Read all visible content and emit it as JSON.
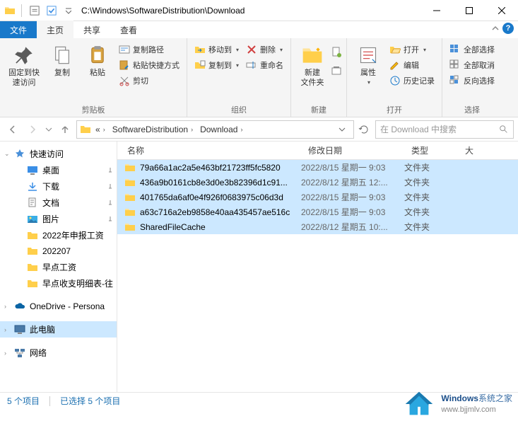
{
  "window": {
    "title": "C:\\Windows\\SoftwareDistribution\\Download"
  },
  "tabs": {
    "file": "文件",
    "home": "主页",
    "share": "共享",
    "view": "查看"
  },
  "ribbon": {
    "clipboard": {
      "pin": "固定到快\n速访问",
      "copy": "复制",
      "paste": "粘贴",
      "cut": "剪切",
      "copy_path": "复制路径",
      "paste_shortcut": "粘贴快捷方式",
      "label": "剪贴板"
    },
    "organize": {
      "move_to": "移动到",
      "copy_to": "复制到",
      "delete": "删除",
      "rename": "重命名",
      "label": "组织"
    },
    "new": {
      "new_folder": "新建\n文件夹",
      "label": "新建"
    },
    "open": {
      "properties": "属性",
      "open": "打开",
      "edit": "编辑",
      "history": "历史记录",
      "label": "打开"
    },
    "select": {
      "select_all": "全部选择",
      "select_none": "全部取消",
      "invert": "反向选择",
      "label": "选择"
    }
  },
  "breadcrumb": {
    "seg1": "SoftwareDistribution",
    "seg2": "Download"
  },
  "search": {
    "placeholder": "在 Download 中搜索"
  },
  "sidebar": {
    "quick_access": "快速访问",
    "desktop": "桌面",
    "downloads": "下载",
    "documents": "文档",
    "pictures": "图片",
    "folder1": "2022年申报工资",
    "folder2": "202207",
    "folder3": "早点工资",
    "folder4": "早点收支明细表-往",
    "onedrive": "OneDrive - Persona",
    "this_pc": "此电脑",
    "network": "网络"
  },
  "columns": {
    "name": "名称",
    "date": "修改日期",
    "type": "类型",
    "size": "大"
  },
  "rows": [
    {
      "name": "79a66a1ac2a5e463bf21723ff5fc5820",
      "date": "2022/8/15 星期一 9:03",
      "type": "文件夹"
    },
    {
      "name": "436a9b0161cb8e3d0e3b82396d1c91...",
      "date": "2022/8/12 星期五 12:...",
      "type": "文件夹"
    },
    {
      "name": "401765da6af0e4f926f0683975c06d3d",
      "date": "2022/8/15 星期一 9:03",
      "type": "文件夹"
    },
    {
      "name": "a63c716a2eb9858e40aa435457ae516c",
      "date": "2022/8/15 星期一 9:03",
      "type": "文件夹"
    },
    {
      "name": "SharedFileCache",
      "date": "2022/8/12 星期五 10:...",
      "type": "文件夹"
    }
  ],
  "status": {
    "count": "5 个项目",
    "selected": "已选择 5 个项目"
  },
  "watermark": {
    "brand_bold": "Windows",
    "brand_rest": "系统之家",
    "url": "www.bjjmlv.com"
  }
}
